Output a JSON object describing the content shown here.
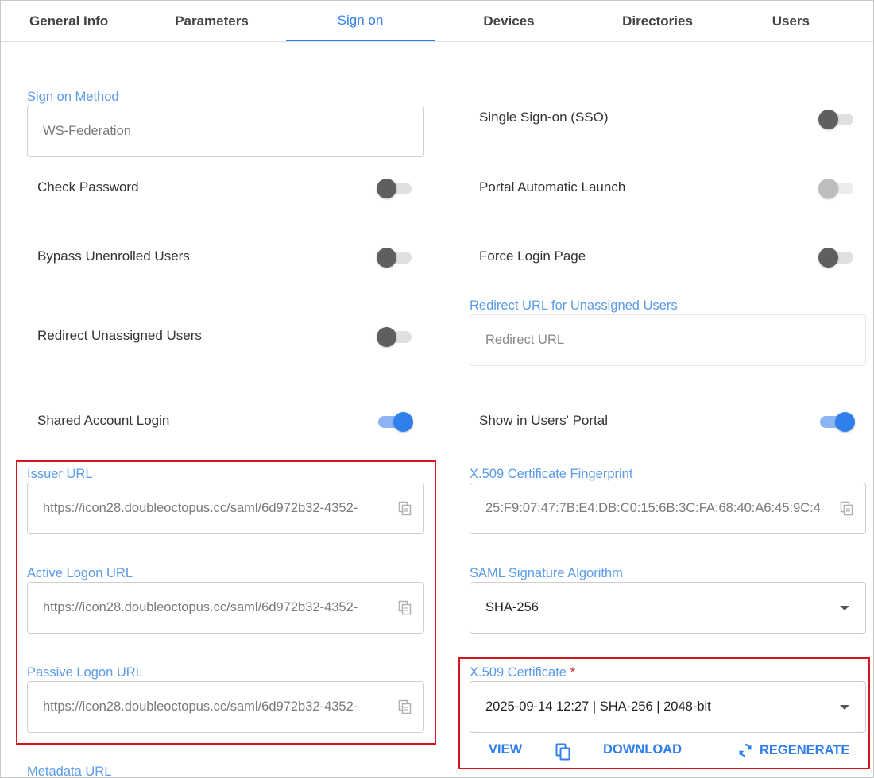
{
  "tabs": [
    {
      "label": "General Info"
    },
    {
      "label": "Parameters"
    },
    {
      "label": "Sign on",
      "active": true
    },
    {
      "label": "Devices"
    },
    {
      "label": "Directories"
    },
    {
      "label": "Users"
    }
  ],
  "sign_on_method": {
    "label": "Sign on Method",
    "value": "WS-Federation"
  },
  "toggles": {
    "sso": {
      "label": "Single Sign-on (SSO)",
      "on": false
    },
    "check_password": {
      "label": "Check Password",
      "on": false
    },
    "portal_auto_launch": {
      "label": "Portal Automatic Launch",
      "on": false,
      "disabled": true
    },
    "bypass_unenrolled": {
      "label": "Bypass Unenrolled Users",
      "on": false
    },
    "force_login": {
      "label": "Force Login Page",
      "on": false
    },
    "redirect_unassigned": {
      "label": "Redirect Unassigned Users",
      "on": false
    },
    "shared_account": {
      "label": "Shared Account Login",
      "on": true
    },
    "show_in_portal": {
      "label": "Show in Users' Portal",
      "on": true
    }
  },
  "redirect_url": {
    "label": "Redirect URL for Unassigned Users",
    "placeholder": "Redirect URL"
  },
  "issuer_url": {
    "label": "Issuer URL",
    "value": "https://icon28.doubleoctopus.cc/saml/6d972b32-4352-"
  },
  "active_logon_url": {
    "label": "Active Logon URL",
    "value": "https://icon28.doubleoctopus.cc/saml/6d972b32-4352-"
  },
  "passive_logon_url": {
    "label": "Passive Logon URL",
    "value": "https://icon28.doubleoctopus.cc/saml/6d972b32-4352-"
  },
  "metadata_url": {
    "label": "Metadata URL"
  },
  "fingerprint": {
    "label": "X.509 Certificate Fingerprint",
    "value": "25:F9:07:47:7B:E4:DB:C0:15:6B:3C:FA:68:40:A6:45:9C:4"
  },
  "signature_algorithm": {
    "label": "SAML Signature Algorithm",
    "value": "SHA-256"
  },
  "certificate": {
    "label": "X.509 Certificate",
    "required_mark": "*",
    "value": "2025-09-14 12:27 | SHA-256 | 2048-bit",
    "actions": {
      "view": "VIEW",
      "download": "DOWNLOAD",
      "regenerate": "REGENERATE"
    }
  },
  "colors": {
    "accent": "#2f80ed",
    "label": "#5a9bea",
    "highlight_border": "#d6141c"
  },
  "icons": {
    "copy": "copy-icon",
    "dropdown": "chevron-down-icon",
    "duplicate": "duplicate-icon",
    "refresh": "refresh-icon"
  }
}
